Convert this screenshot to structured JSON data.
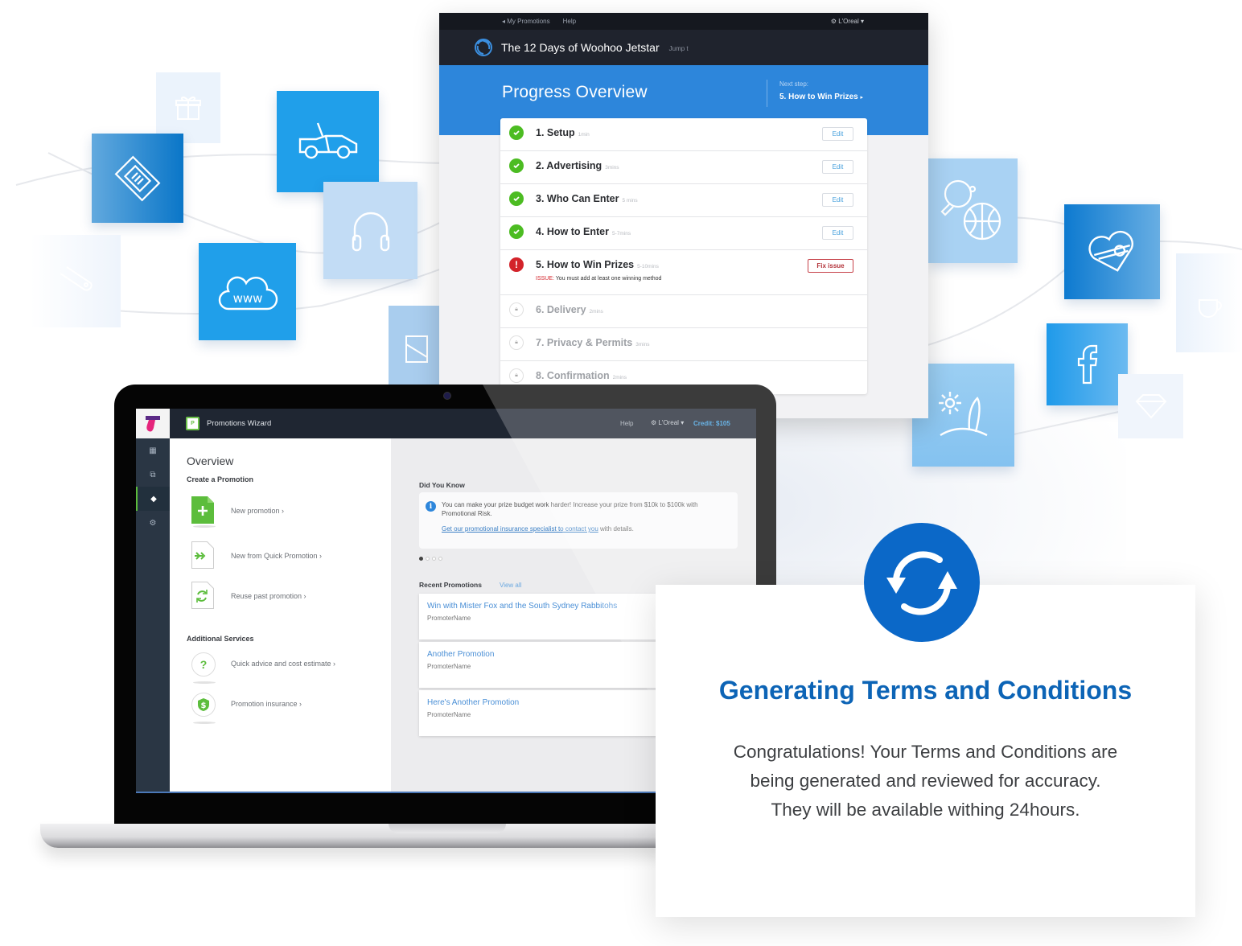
{
  "progress_window": {
    "topbar": {
      "back_link": "My Promotions",
      "help": "Help",
      "account": "L'Oreal"
    },
    "title": "The 12 Days of Woohoo Jetstar",
    "jump": "Jump t",
    "hero_title": "Progress Overview",
    "next_step_label": "Next step:",
    "next_step_value": "5. How to Win Prizes",
    "steps": [
      {
        "label": "1. Setup",
        "duration": "1min",
        "status": "complete",
        "action": "Edit"
      },
      {
        "label": "2. Advertising",
        "duration": "3mins",
        "status": "complete",
        "action": "Edit"
      },
      {
        "label": "3. Who Can Enter",
        "duration": "5 mins",
        "status": "complete",
        "action": "Edit"
      },
      {
        "label": "4. How to Enter",
        "duration": "5-7mins",
        "status": "complete",
        "action": "Edit"
      },
      {
        "label": "5. How to Win Prizes",
        "duration": "5-10mins",
        "status": "issue",
        "action": "Fix issue",
        "issue_label": "ISSUE:",
        "issue_text": "You must add at least one winning method"
      },
      {
        "label": "6. Delivery",
        "duration": "2mins",
        "status": "locked"
      },
      {
        "label": "7. Privacy & Permits",
        "duration": "3mins",
        "status": "locked"
      },
      {
        "label": "8. Confirmation",
        "duration": "2mins",
        "status": "locked"
      }
    ]
  },
  "laptop_app": {
    "app_name": "Promotions Wizard",
    "app_icon_letter": "P",
    "help": "Help",
    "account": "L'Oreal",
    "credit": "Credit: $105",
    "overview_title": "Overview",
    "create_heading": "Create a Promotion",
    "create_actions": [
      {
        "label": "New promotion ›",
        "icon": "new-document-icon"
      },
      {
        "label": "New from Quick Promotion ›",
        "icon": "quick-forward-icon"
      },
      {
        "label": "Reuse past promotion ›",
        "icon": "reuse-refresh-icon"
      }
    ],
    "services_heading": "Additional Services",
    "services": [
      {
        "label": "Quick advice and cost estimate ›",
        "icon": "question-icon"
      },
      {
        "label": "Promotion insurance ›",
        "icon": "shield-dollar-icon"
      }
    ],
    "did_you_know": {
      "heading": "Did You Know",
      "text": "You can make your prize budget work harder! Increase your prize from $10k to $100k with Promotional Risk.",
      "link": "Get our promotional insurance specialist to contact you",
      "link_suffix": " with details.",
      "carousel_pages": 4,
      "carousel_active": 1
    },
    "recent": {
      "heading": "Recent Promotions",
      "view_all": "View all",
      "items": [
        {
          "title": "Win with Mister Fox and the South Sydney Rabbitohs",
          "promoter": "PromoterName"
        },
        {
          "title": "Another Promotion",
          "promoter": "PromoterName"
        },
        {
          "title": "Here's Another Promotion",
          "promoter": "PromoterName"
        }
      ]
    }
  },
  "card": {
    "title": "Generating Terms and Conditions",
    "line1": "Congratulations! Your Terms and Conditions are",
    "line2": "being generated and reviewed for accuracy.",
    "line3": "They will be available withing 24hours."
  },
  "decor_icons": [
    "gift-icon",
    "ticket-icon",
    "car-icon",
    "headphones-icon",
    "cloud-www-icon",
    "gamepad-icon",
    "envelope-icon",
    "ping-pong-basketball-icon",
    "heart-box-icon",
    "facebook-icon",
    "beach-surf-icon",
    "diamond-icon",
    "coffee-icon"
  ],
  "colors": {
    "brand_blue": "#2d86db",
    "title_blue": "#0c64b6",
    "success_green": "#4cbc22",
    "error_red": "#d3232a",
    "dark_bar": "#1f232d"
  }
}
